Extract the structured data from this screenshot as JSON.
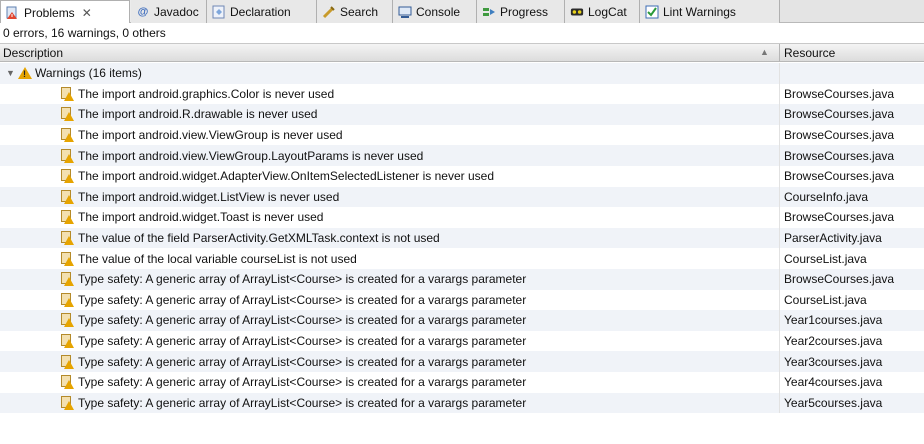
{
  "tabs": [
    {
      "label": "Problems",
      "icon": "problems-icon",
      "active": true
    },
    {
      "label": "Javadoc",
      "icon": "javadoc-icon"
    },
    {
      "label": "Declaration",
      "icon": "declaration-icon"
    },
    {
      "label": "Search",
      "icon": "search-icon"
    },
    {
      "label": "Console",
      "icon": "console-icon"
    },
    {
      "label": "Progress",
      "icon": "progress-icon"
    },
    {
      "label": "LogCat",
      "icon": "logcat-icon"
    },
    {
      "label": "Lint Warnings",
      "icon": "lint-icon"
    }
  ],
  "tab_close": "✕",
  "summary": "0 errors, 16 warnings, 0 others",
  "columns": {
    "description": "Description",
    "resource": "Resource"
  },
  "group": {
    "label": "Warnings (16 items)"
  },
  "rows": [
    {
      "desc": "The import android.graphics.Color is never used",
      "res": "BrowseCourses.java"
    },
    {
      "desc": "The import android.R.drawable is never used",
      "res": "BrowseCourses.java"
    },
    {
      "desc": "The import android.view.ViewGroup is never used",
      "res": "BrowseCourses.java"
    },
    {
      "desc": "The import android.view.ViewGroup.LayoutParams is never used",
      "res": "BrowseCourses.java"
    },
    {
      "desc": "The import android.widget.AdapterView.OnItemSelectedListener is never used",
      "res": "BrowseCourses.java"
    },
    {
      "desc": "The import android.widget.ListView is never used",
      "res": "CourseInfo.java"
    },
    {
      "desc": "The import android.widget.Toast is never used",
      "res": "BrowseCourses.java"
    },
    {
      "desc": "The value of the field ParserActivity.GetXMLTask.context is not used",
      "res": "ParserActivity.java"
    },
    {
      "desc": "The value of the local variable courseList is not used",
      "res": "CourseList.java"
    },
    {
      "desc": "Type safety: A generic array of ArrayList<Course> is created for a varargs parameter",
      "res": "BrowseCourses.java"
    },
    {
      "desc": "Type safety: A generic array of ArrayList<Course> is created for a varargs parameter",
      "res": "CourseList.java"
    },
    {
      "desc": "Type safety: A generic array of ArrayList<Course> is created for a varargs parameter",
      "res": "Year1courses.java"
    },
    {
      "desc": "Type safety: A generic array of ArrayList<Course> is created for a varargs parameter",
      "res": "Year2courses.java"
    },
    {
      "desc": "Type safety: A generic array of ArrayList<Course> is created for a varargs parameter",
      "res": "Year3courses.java"
    },
    {
      "desc": "Type safety: A generic array of ArrayList<Course> is created for a varargs parameter",
      "res": "Year4courses.java"
    },
    {
      "desc": "Type safety: A generic array of ArrayList<Course> is created for a varargs parameter",
      "res": "Year5courses.java"
    }
  ]
}
